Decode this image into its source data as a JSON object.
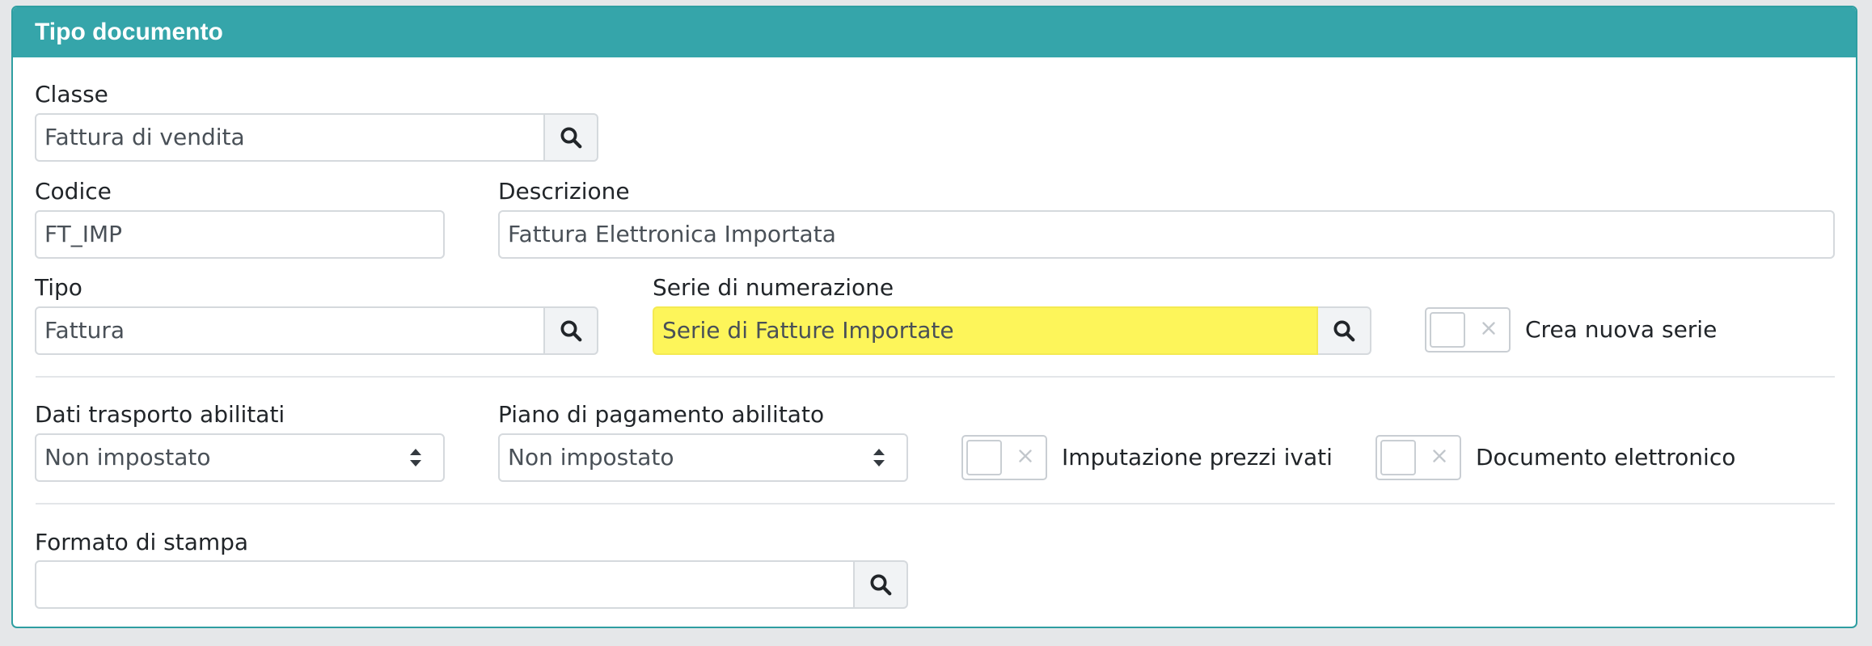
{
  "panel": {
    "title": "Tipo documento"
  },
  "form": {
    "classe": {
      "label": "Classe",
      "value": "Fattura di vendita"
    },
    "codice": {
      "label": "Codice",
      "value": "FT_IMP"
    },
    "descrizione": {
      "label": "Descrizione",
      "value": "Fattura Elettronica Importata"
    },
    "tipo": {
      "label": "Tipo",
      "value": "Fattura"
    },
    "serie": {
      "label": "Serie di numerazione",
      "value": "Serie di Fatture Importate"
    },
    "crea_nuova_serie": {
      "label": "Crea nuova serie",
      "checked": false
    },
    "dati_trasporto": {
      "label": "Dati trasporto abilitati",
      "value": "Non impostato"
    },
    "piano_pagamento": {
      "label": "Piano di pagamento abilitato",
      "value": "Non impostato"
    },
    "imputazione_prezzi": {
      "label": "Imputazione prezzi ivati",
      "checked": false
    },
    "documento_elettronico": {
      "label": "Documento elettronico",
      "checked": false
    },
    "formato_stampa": {
      "label": "Formato di stampa",
      "value": ""
    }
  },
  "icons": {
    "lookup": "search-icon",
    "select": "sort-caret-icon",
    "toggle_off": "close-icon"
  },
  "colors": {
    "header": "#35a5aa",
    "highlight": "#fdf55a"
  }
}
